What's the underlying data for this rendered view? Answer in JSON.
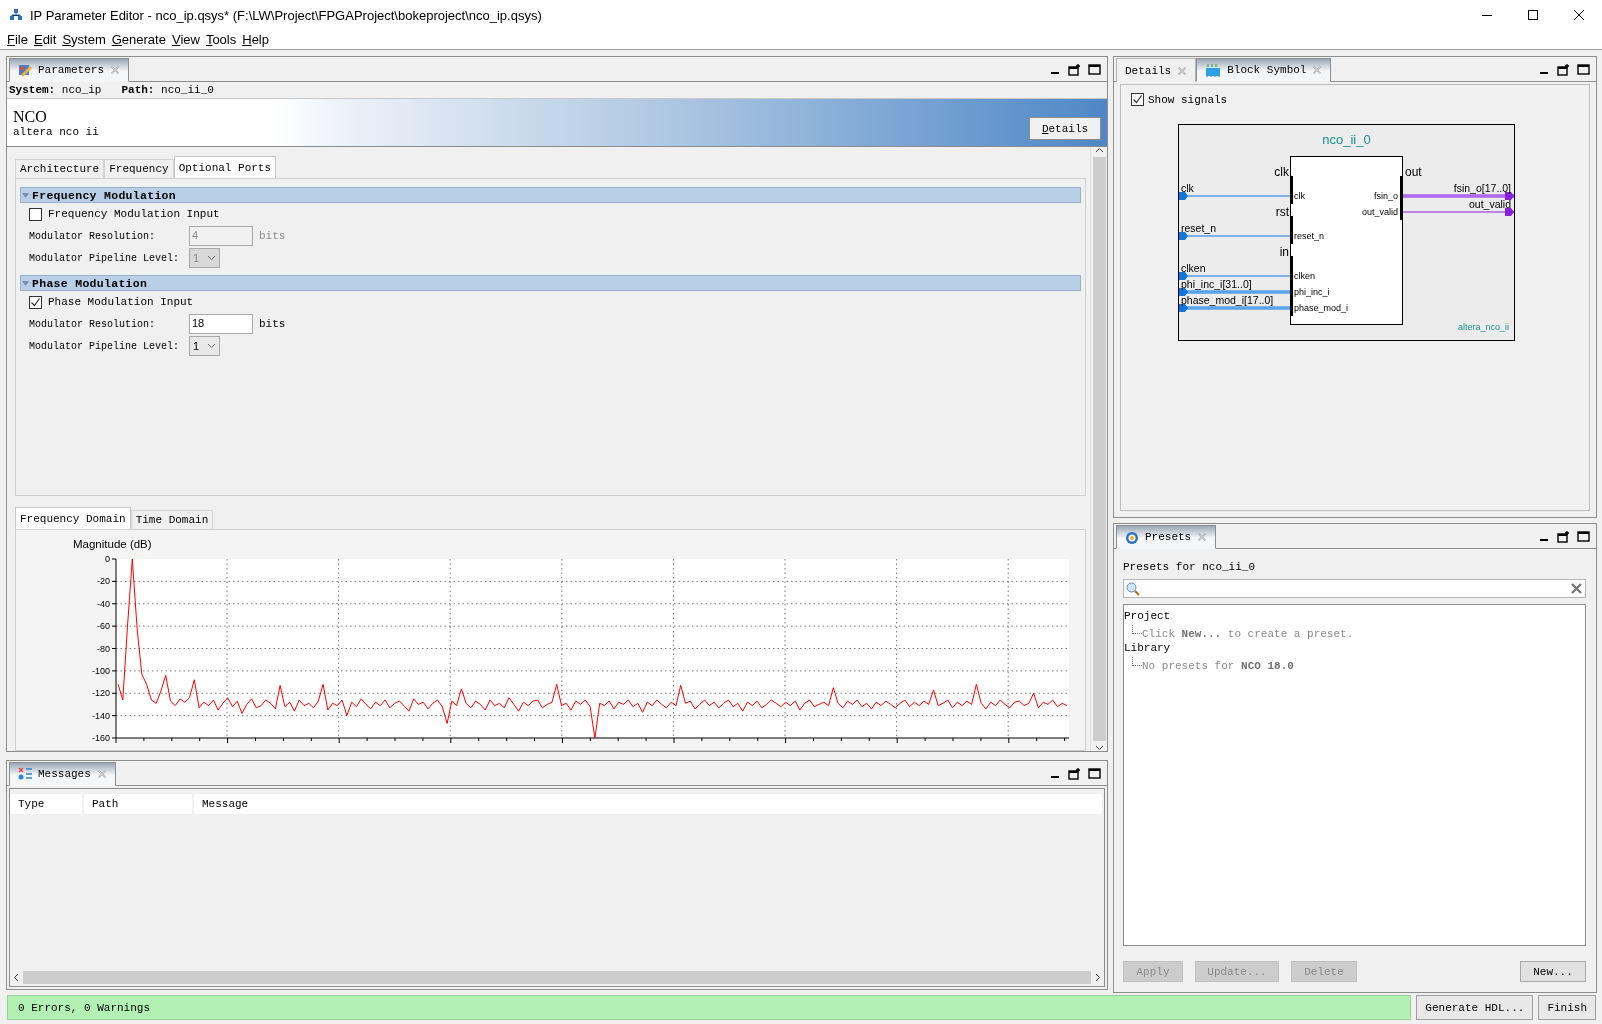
{
  "window": {
    "title": "IP Parameter Editor - nco_ip.qsys* (F:\\LW\\Project\\FPGAProject\\bokeproject\\nco_ip.qsys)"
  },
  "menu": [
    "File",
    "Edit",
    "System",
    "Generate",
    "View",
    "Tools",
    "Help"
  ],
  "parameters_panel": {
    "tab": "Parameters",
    "system_label": "System:",
    "system": "nco_ip",
    "path_label": "Path:",
    "path": "nco_ii_0",
    "component_title": "NCO",
    "component_name": "altera nco ii",
    "details_button": "Details",
    "tabs": [
      {
        "label": "Architecture",
        "selected": false
      },
      {
        "label": "Frequency",
        "selected": false
      },
      {
        "label": "Optional Ports",
        "selected": true
      }
    ],
    "sections": [
      {
        "title": "Frequency Modulation",
        "expanded": true,
        "enable": {
          "label": "Frequency Modulation Input",
          "checked": false
        },
        "resolution": {
          "label": "Modulator Resolution:",
          "value": "4",
          "unit": "bits"
        },
        "pipeline": {
          "label": "Modulator Pipeline Level:",
          "value": "1"
        }
      },
      {
        "title": "Phase Modulation",
        "expanded": true,
        "enable": {
          "label": "Phase Modulation Input",
          "checked": true
        },
        "resolution": {
          "label": "Modulator Resolution:",
          "value": "18",
          "unit": "bits"
        },
        "pipeline": {
          "label": "Modulator Pipeline Level:",
          "value": "1"
        }
      }
    ],
    "plot_tabs": [
      {
        "label": "Frequency Domain",
        "selected": true
      },
      {
        "label": "Time Domain",
        "selected": false
      }
    ],
    "plot": {
      "chart_data": {
        "type": "line",
        "grid": true,
        "ylabel": "Magnitude (dB)",
        "ylim": [
          -160,
          0
        ],
        "yticks": [
          0,
          -20,
          -40,
          -60,
          -80,
          -100,
          -120,
          -140,
          -160
        ],
        "series": [
          {
            "color": "#ff0000",
            "values": [
              -112,
              -126,
              -60,
              0,
              -62,
              -103,
              -112,
              -126,
              -129,
              -118,
              -104,
              -127,
              -131,
              -125,
              -128,
              -124,
              -108,
              -133,
              -128,
              -131,
              -126,
              -135,
              -129,
              -124,
              -132,
              -127,
              -138,
              -130,
              -125,
              -133,
              -131,
              -126,
              -129,
              -134,
              -113,
              -132,
              -128,
              -136,
              -126,
              -131,
              -129,
              -133,
              -127,
              -112,
              -135,
              -129,
              -131,
              -126,
              -140,
              -128,
              -132,
              -125,
              -130,
              -134,
              -128,
              -131,
              -126,
              -133,
              -129,
              -127,
              -131,
              -136,
              -125,
              -130,
              -128,
              -134,
              -129,
              -126,
              -132,
              -147,
              -127,
              -131,
              -116,
              -129,
              -133,
              -127,
              -130,
              -135,
              -126,
              -131,
              -129,
              -133,
              -124,
              -130,
              -136,
              -128,
              -131,
              -127,
              -126,
              -133,
              -130,
              -128,
              -112,
              -131,
              -129,
              -135,
              -127,
              -130,
              -126,
              -132,
              -160,
              -129,
              -131,
              -127,
              -134,
              -128,
              -130,
              -126,
              -132,
              -129,
              -137,
              -128,
              -131,
              -126,
              -130,
              -133,
              -128,
              -131,
              -113,
              -129,
              -127,
              -134,
              -130,
              -126,
              -131,
              -128,
              -133,
              -129,
              -126,
              -132,
              -129,
              -136,
              -128,
              -131,
              -127,
              -133,
              -130,
              -126,
              -129,
              -132,
              -128,
              -131,
              -127,
              -135,
              -129,
              -126,
              -132,
              -130,
              -128,
              -131,
              -115,
              -129,
              -133,
              -127,
              -130,
              -126,
              -132,
              -129,
              -134,
              -128,
              -131,
              -127,
              -130,
              -133,
              -129,
              -126,
              -132,
              -128,
              -131,
              -127,
              -130,
              -117,
              -131,
              -129,
              -126,
              -133,
              -128,
              -131,
              -127,
              -130,
              -112,
              -129,
              -134,
              -128,
              -131,
              -126,
              -130,
              -133,
              -128,
              -127,
              -131,
              -129,
              -120,
              -133,
              -128,
              -130,
              -126,
              -132,
              -129,
              -131
            ]
          }
        ]
      }
    }
  },
  "messages_panel": {
    "tab": "Messages",
    "columns": [
      "Type",
      "Path",
      "Message"
    ]
  },
  "status_bar": {
    "text": "0 Errors, 0 Warnings",
    "buttons": [
      "Generate HDL...",
      "Finish"
    ]
  },
  "symbol_panel": {
    "tabs": [
      {
        "label": "Details",
        "selected": false
      },
      {
        "label": "Block Symbol",
        "selected": true
      }
    ],
    "show_signals": {
      "label": "Show signals",
      "checked": true
    },
    "block": {
      "instance": "nco_ii_0",
      "module": "altera_nco_ii",
      "left_interfaces": [
        {
          "name": "clk",
          "ports": [
            {
              "external": "clk",
              "internal": "clk",
              "bus": false
            }
          ]
        },
        {
          "name": "rst",
          "ports": [
            {
              "external": "reset_n",
              "internal": "reset_n",
              "bus": false
            }
          ]
        },
        {
          "name": "in",
          "ports": [
            {
              "external": "clken",
              "internal": "clken",
              "bus": false
            },
            {
              "external": "phi_inc_i[31..0]",
              "internal": "phi_inc_i",
              "bus": true
            },
            {
              "external": "phase_mod_i[17..0]",
              "internal": "phase_mod_i",
              "bus": true
            }
          ]
        }
      ],
      "right_interfaces": [
        {
          "name": "out",
          "ports": [
            {
              "external": "fsin_o[17..0]",
              "internal": "fsin_o",
              "bus": true
            },
            {
              "external": "out_valid",
              "internal": "out_valid",
              "bus": false
            }
          ]
        }
      ]
    }
  },
  "presets_panel": {
    "tab": "Presets",
    "heading": "Presets for nco_ii_0",
    "tree": [
      {
        "label": "Project",
        "children": [
          {
            "label": "Click **New...** to create a preset."
          }
        ]
      },
      {
        "label": "Library",
        "children": [
          {
            "label": "No presets for **NCO 18.0**"
          }
        ]
      }
    ],
    "buttons": [
      {
        "label": "Apply",
        "disabled": true
      },
      {
        "label": "Update...",
        "disabled": true
      },
      {
        "label": "Delete",
        "disabled": true
      },
      {
        "label": "New...",
        "disabled": false
      }
    ]
  }
}
